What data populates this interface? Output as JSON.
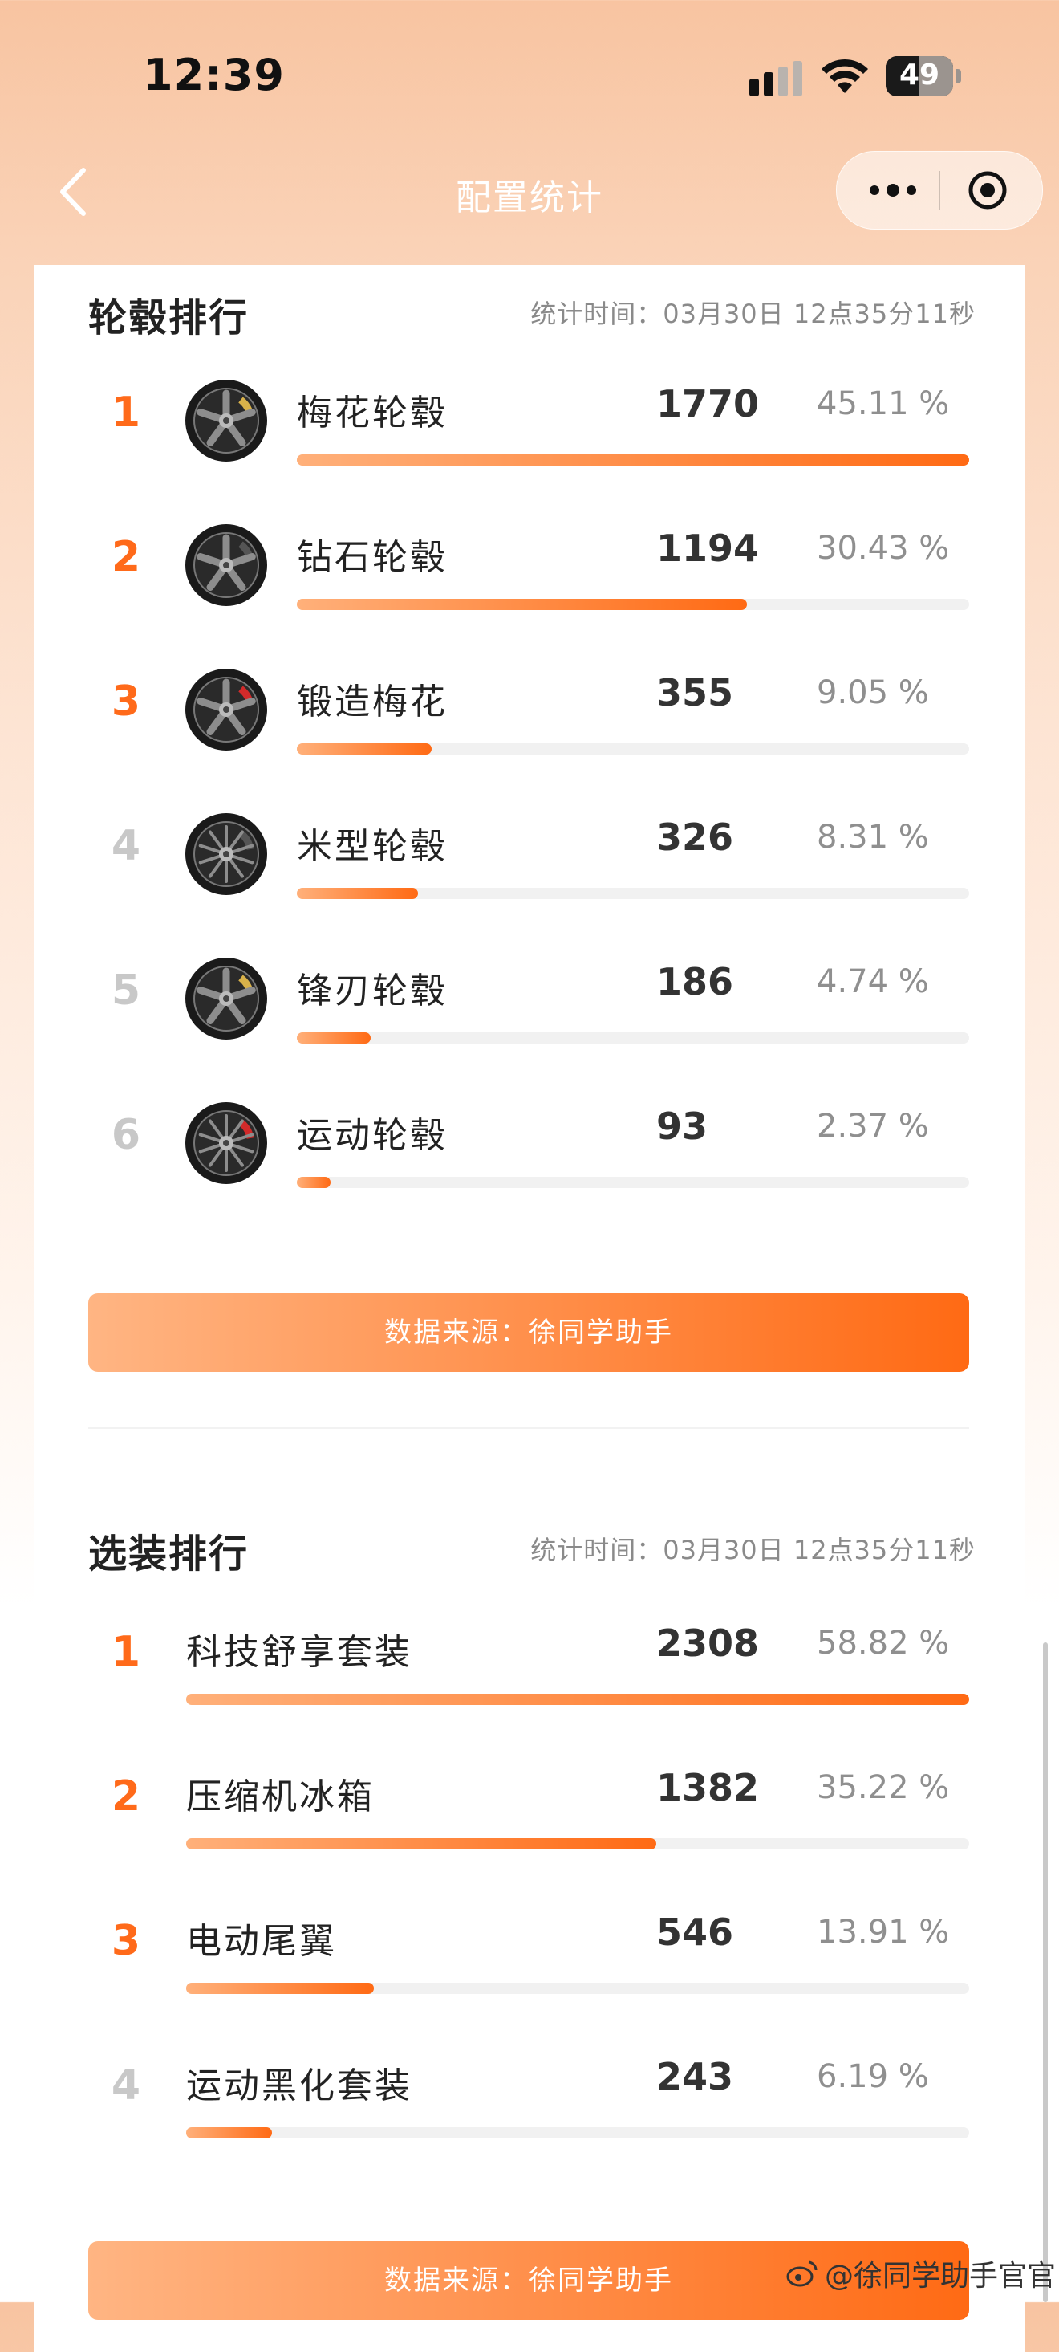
{
  "status_bar": {
    "time": "12:39",
    "battery": "49",
    "battery_level": 0.49
  },
  "navbar": {
    "title": "配置统计"
  },
  "wheels": {
    "title": "轮毂排行",
    "stat_time": "统计时间：03月30日 12点35分11秒",
    "items": [
      {
        "rank": "1",
        "name": "梅花轮毂",
        "count": "1770",
        "percent": "45.11 %",
        "share": 1.0,
        "icon": "five-spoke-wheel-icon",
        "caliper": "#d9b24a"
      },
      {
        "rank": "2",
        "name": "钻石轮毂",
        "count": "1194",
        "percent": "30.43 %",
        "share": 0.67,
        "icon": "diamond-wheel-icon",
        "caliper": "#555555"
      },
      {
        "rank": "3",
        "name": "锻造梅花",
        "count": "355",
        "percent": "9.05 %",
        "share": 0.2,
        "icon": "forged-wheel-icon",
        "caliper": "#d22a2a"
      },
      {
        "rank": "4",
        "name": "米型轮毂",
        "count": "326",
        "percent": "8.31 %",
        "share": 0.18,
        "icon": "mesh-wheel-icon",
        "caliper": "#555555"
      },
      {
        "rank": "5",
        "name": "锋刃轮毂",
        "count": "186",
        "percent": "4.74 %",
        "share": 0.11,
        "icon": "blade-wheel-icon",
        "caliper": "#d9b24a"
      },
      {
        "rank": "6",
        "name": "运动轮毂",
        "count": "93",
        "percent": "2.37 %",
        "share": 0.05,
        "icon": "sport-wheel-icon",
        "caliper": "#d22a2a"
      }
    ],
    "source": "数据来源：徐同学助手"
  },
  "options": {
    "title": "选装排行",
    "stat_time": "统计时间：03月30日 12点35分11秒",
    "items": [
      {
        "rank": "1",
        "name": "科技舒享套装",
        "count": "2308",
        "percent": "58.82 %",
        "share": 1.0
      },
      {
        "rank": "2",
        "name": "压缩机冰箱",
        "count": "1382",
        "percent": "35.22 %",
        "share": 0.6
      },
      {
        "rank": "3",
        "name": "电动尾翼",
        "count": "546",
        "percent": "13.91 %",
        "share": 0.24
      },
      {
        "rank": "4",
        "name": "运动黑化套装",
        "count": "243",
        "percent": "6.19 %",
        "share": 0.11
      }
    ],
    "source": "数据来源：徐同学助手"
  },
  "watermark": "@徐同学助手官官",
  "colors": {
    "accent": "#ff6a14",
    "accent_light": "#ffb07a",
    "rank_muted": "#c8c8c8"
  }
}
